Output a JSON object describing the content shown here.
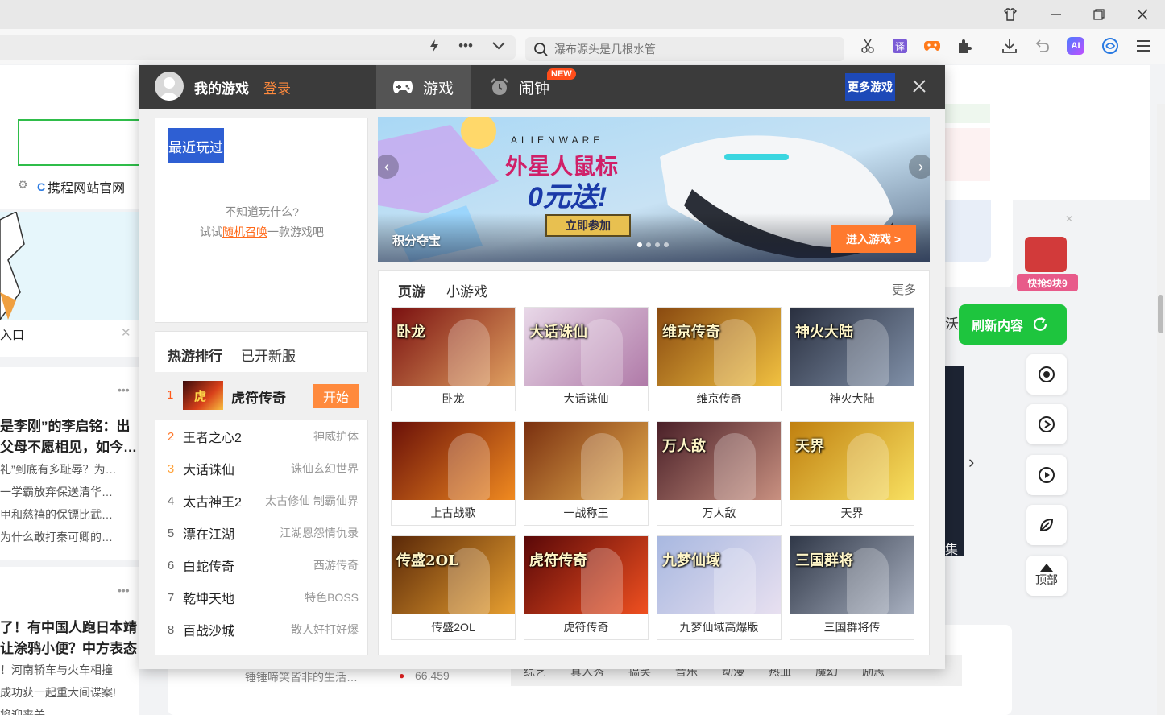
{
  "browser": {
    "search_placeholder": "瀑布源头是几根水管"
  },
  "background": {
    "sidebar_link": "携程网站官网",
    "entry_label": "入口",
    "news": [
      "是李刚”的李启铭：出",
      "父母不愿相见，如今…",
      "礼”到底有多耻辱？为…",
      "一学霸放弃保送清华…",
      "甲和慈禧的保镖比武…",
      "为什么敢打秦可卿的…",
      "了！有中国人跑日本靖",
      "让涂鸦小便？中方表态",
      "！河南轿车与火车相撞",
      "成功获一起重大间谍案!",
      "将迎来美"
    ],
    "refresh_label": "刷新内容",
    "top_label": "顶部",
    "promo_label": "快抢9块9",
    "bottom_left": "锤锤啼笑皆非的生活…",
    "bottom_count": "66,459",
    "bottom_tags": [
      "综艺",
      "真人秀",
      "搞笑",
      "音乐",
      "动漫",
      "热血",
      "魔幻",
      "励志"
    ],
    "side_char": "沃",
    "side_char2": "集"
  },
  "popup": {
    "my_games": "我的游戏",
    "login": "登录",
    "tab_games": "游戏",
    "tab_alarm": "闹钟",
    "new_badge": "NEW",
    "more_games": "更多游戏",
    "recent": {
      "tag": "最近玩过",
      "hint1": "不知道玩什么?",
      "hint2_prefix": "试试",
      "hint2_link": "随机召唤",
      "hint2_suffix": "一款游戏吧"
    },
    "ranking": {
      "tab_hot": "热游排行",
      "tab_servers": "已开新服",
      "start_label": "开始",
      "rows": [
        {
          "num": "1",
          "name": "虎符传奇",
          "tag": ""
        },
        {
          "num": "2",
          "name": "王者之心2",
          "tag": "神威护体"
        },
        {
          "num": "3",
          "name": "大话诛仙",
          "tag": "诛仙玄幻世界"
        },
        {
          "num": "4",
          "name": "太古神王2",
          "tag": "太古修仙 制霸仙界"
        },
        {
          "num": "5",
          "name": "漂在江湖",
          "tag": "江湖恩怨情仇录"
        },
        {
          "num": "6",
          "name": "白蛇传奇",
          "tag": "西游传奇"
        },
        {
          "num": "7",
          "name": "乾坤天地",
          "tag": "特色BOSS"
        },
        {
          "num": "8",
          "name": "百战沙城",
          "tag": "散人好打好爆"
        }
      ]
    },
    "banner": {
      "brand": "ALIENWARE",
      "headline1": "外星人鼠标",
      "headline2": "0元送!",
      "cta": "立即参加",
      "label": "积分夺宝",
      "enter": "进入游戏 >"
    },
    "games": {
      "tab_web": "页游",
      "tab_mini": "小游戏",
      "more": "更多",
      "items": [
        {
          "name": "卧龙",
          "logo": "卧龙",
          "c1": "#7a1010",
          "c2": "#e0a060"
        },
        {
          "name": "大话诛仙",
          "logo": "大话诛仙",
          "c1": "#e8d8e8",
          "c2": "#b07aa8"
        },
        {
          "name": "维京传奇",
          "logo": "维京传奇",
          "c1": "#8a4a10",
          "c2": "#f0c040"
        },
        {
          "name": "神火大陆",
          "logo": "神火大陆",
          "c1": "#2a3040",
          "c2": "#8090a8"
        },
        {
          "name": "上古战歌",
          "logo": "",
          "c1": "#6a1008",
          "c2": "#f08a20"
        },
        {
          "name": "一战称王",
          "logo": "",
          "c1": "#7a3010",
          "c2": "#e8b050"
        },
        {
          "name": "万人敌",
          "logo": "万人敌",
          "c1": "#4a2028",
          "c2": "#c89080"
        },
        {
          "name": "天界",
          "logo": "天界",
          "c1": "#c08010",
          "c2": "#f8e060"
        },
        {
          "name": "传盛2OL",
          "logo": "传盛2OL",
          "c1": "#5a2808",
          "c2": "#e8a030"
        },
        {
          "name": "虎符传奇",
          "logo": "虎符传奇",
          "c1": "#5a0808",
          "c2": "#f05020"
        },
        {
          "name": "九梦仙域高爆版",
          "logo": "九梦仙域",
          "c1": "#a8b8e0",
          "c2": "#e8e0f0"
        },
        {
          "name": "三国群将传",
          "logo": "三国群将",
          "c1": "#303848",
          "c2": "#a8b0c0"
        }
      ]
    }
  }
}
